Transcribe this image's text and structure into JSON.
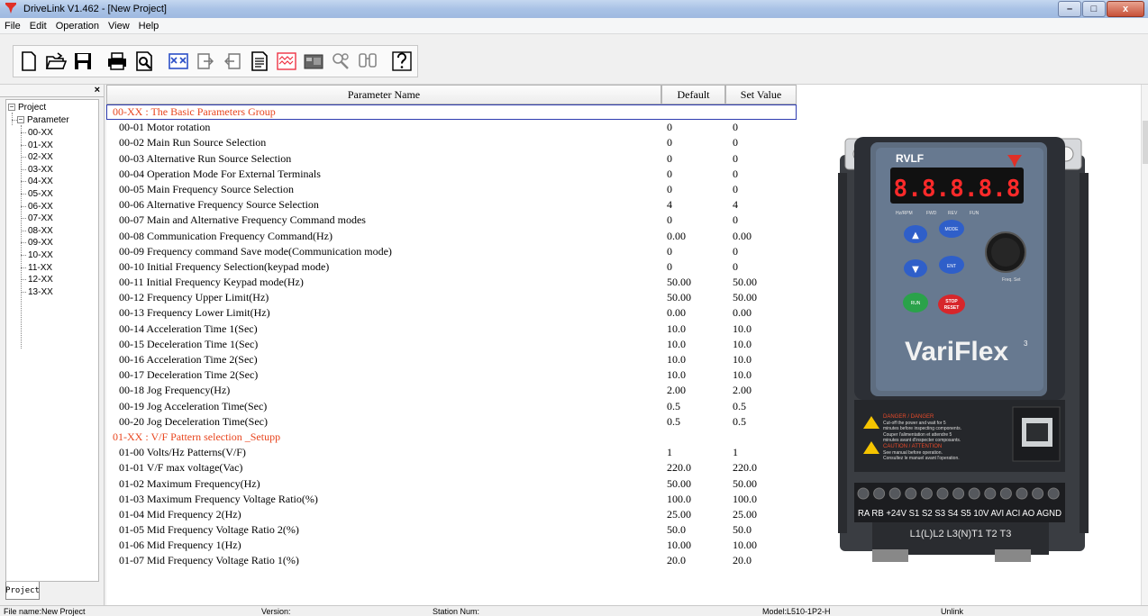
{
  "window": {
    "title": "DriveLink V1.462 - [New Project]",
    "controls": {
      "minimize": "–",
      "maximize": "□",
      "close": "x"
    }
  },
  "menu": [
    "File",
    "Edit",
    "Operation",
    "View",
    "Help"
  ],
  "toolbar": [
    "new-icon",
    "open-icon",
    "save-icon",
    "print-icon",
    "print-preview-icon",
    "compare-icon",
    "upload-icon",
    "download-icon",
    "sheet-icon",
    "monitor-icon",
    "status-icon",
    "tools-icon",
    "search-icon",
    "help-icon"
  ],
  "tree": {
    "root": "Project",
    "node": "Parameter",
    "children": [
      "00-XX",
      "01-XX",
      "02-XX",
      "03-XX",
      "04-XX",
      "05-XX",
      "06-XX",
      "07-XX",
      "08-XX",
      "09-XX",
      "10-XX",
      "11-XX",
      "12-XX",
      "13-XX"
    ],
    "tab": "Project",
    "close": "×"
  },
  "table": {
    "headers": {
      "name": "Parameter Name",
      "default": "Default",
      "set": "Set Value"
    },
    "rows": [
      {
        "name": "00-XX : The Basic Parameters Group",
        "default": "",
        "set": "",
        "group": true
      },
      {
        "name": "00-01 Motor rotation",
        "default": "0",
        "set": "0"
      },
      {
        "name": "00-02 Main Run Source Selection",
        "default": "0",
        "set": "0"
      },
      {
        "name": "00-03 Alternative Run Source Selection",
        "default": "0",
        "set": "0"
      },
      {
        "name": "00-04 Operation Mode For External Terminals",
        "default": "0",
        "set": "0"
      },
      {
        "name": "00-05 Main Frequency Source Selection",
        "default": "0",
        "set": "0"
      },
      {
        "name": "00-06 Alternative Frequency Source Selection",
        "default": "4",
        "set": "4"
      },
      {
        "name": "00-07 Main and Alternative Frequency Command modes",
        "default": "0",
        "set": "0"
      },
      {
        "name": "00-08 Communication Frequency Command(Hz)",
        "default": "0.00",
        "set": "0.00"
      },
      {
        "name": "00-09 Frequency command Save mode(Communication mode)",
        "default": "0",
        "set": "0"
      },
      {
        "name": "00-10 Initial Frequency Selection(keypad mode)",
        "default": "0",
        "set": "0"
      },
      {
        "name": "00-11 Initial Frequency Keypad mode(Hz)",
        "default": "50.00",
        "set": "50.00"
      },
      {
        "name": "00-12 Frequency Upper Limit(Hz)",
        "default": "50.00",
        "set": "50.00"
      },
      {
        "name": "00-13 Frequency Lower Limit(Hz)",
        "default": "0.00",
        "set": "0.00"
      },
      {
        "name": "00-14 Acceleration Time 1(Sec)",
        "default": "10.0",
        "set": "10.0"
      },
      {
        "name": "00-15 Deceleration Time 1(Sec)",
        "default": "10.0",
        "set": "10.0"
      },
      {
        "name": "00-16 Acceleration Time 2(Sec)",
        "default": "10.0",
        "set": "10.0"
      },
      {
        "name": "00-17 Deceleration Time 2(Sec)",
        "default": "10.0",
        "set": "10.0"
      },
      {
        "name": "00-18 Jog Frequency(Hz)",
        "default": "2.00",
        "set": "2.00"
      },
      {
        "name": "00-19 Jog Acceleration Time(Sec)",
        "default": "0.5",
        "set": "0.5"
      },
      {
        "name": "00-20 Jog Deceleration Time(Sec)",
        "default": "0.5",
        "set": "0.5"
      },
      {
        "name": "01-XX : V/F Pattern selection _Setup​p",
        "default": "",
        "set": "",
        "group": true
      },
      {
        "name": "01-00 Volts/Hz Patterns(V/F)",
        "default": "1",
        "set": "1"
      },
      {
        "name": "01-01 V/F max voltage(Vac)",
        "default": "220.0",
        "set": "220.0"
      },
      {
        "name": "01-02 Maximum Frequency(Hz)",
        "default": "50.00",
        "set": "50.00"
      },
      {
        "name": "01-03 Maximum Frequency Voltage Ratio(%)",
        "default": "100.0",
        "set": "100.0"
      },
      {
        "name": "01-04 Mid Frequency 2(Hz)",
        "default": "25.00",
        "set": "25.00"
      },
      {
        "name": "01-05 Mid Frequency Voltage Ratio 2(%)",
        "default": "50.0",
        "set": "50.0"
      },
      {
        "name": "01-06 Mid Frequency 1(Hz)",
        "default": "10.00",
        "set": "10.00"
      },
      {
        "name": "01-07 Mid Frequency Voltage Ratio 1(%)",
        "default": "20.0",
        "set": "20.0"
      }
    ]
  },
  "device": {
    "model_label": "RVLF",
    "display": "8.8.8.8.8",
    "indicators": [
      "Hz/RPM",
      "FWD",
      "REV",
      "FUN"
    ],
    "keys": {
      "up": "▲",
      "mode": "MODE",
      "down": "▼",
      "ent": "ENT",
      "run": "RUN",
      "stop": "STOP",
      "reset": "RESET",
      "freq": "Freq. Set"
    },
    "brand": "VariFlex",
    "brand_sup": "3",
    "warning": {
      "l1": "DANGER / DANGER",
      "l2": "Cut-off the power and wait for 5",
      "l3": "minutes before inspecting components.",
      "l4": "Couper l'alimentation et attendre 5",
      "l5": "minutes avant d'inspecter composants.",
      "l6": "CAUTION / ATTENTION",
      "l7": "See manual before operation.",
      "l8": "Consultez le manuel avant l'operation."
    },
    "terminals": "RA RB +24V S1 S2 S3 S4 S5 10V AVI ACI AO AGND",
    "power_terminals": "L1(L)L2 L3(N)T1  T2  T3"
  },
  "status": {
    "file": "File name:New Project",
    "version": "Version:",
    "station": "Station Num:",
    "model": "Model:L510-1P2-H",
    "link": "Unlink"
  }
}
